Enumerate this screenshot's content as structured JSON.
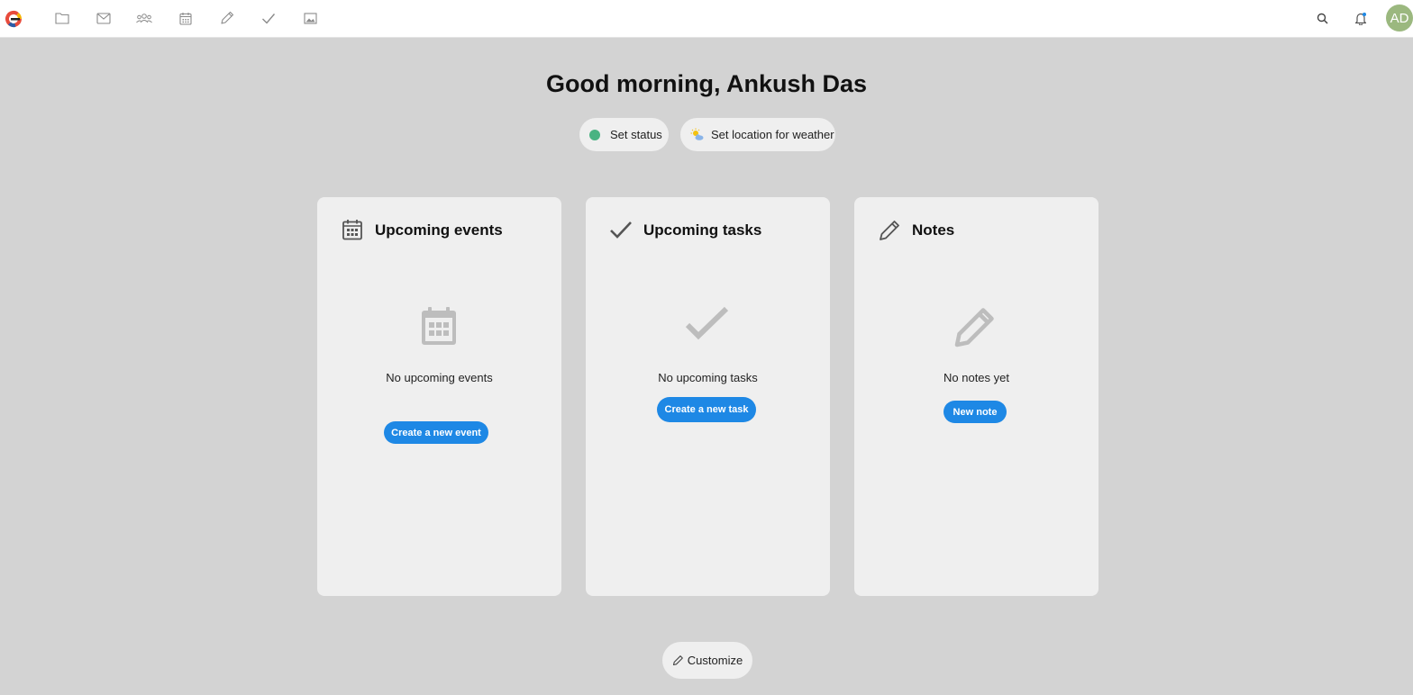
{
  "topbar": {
    "apps": [
      {
        "icon": "folder-icon",
        "label": "Files"
      },
      {
        "icon": "mail-icon",
        "label": "Mail"
      },
      {
        "icon": "contacts-icon",
        "label": "Contacts"
      },
      {
        "icon": "calendar-icon",
        "label": "Calendar"
      },
      {
        "icon": "pencil-icon",
        "label": "Notes"
      },
      {
        "icon": "check-icon",
        "label": "Tasks"
      },
      {
        "icon": "image-icon",
        "label": "Photos"
      }
    ],
    "avatar_initials": "AD",
    "avatar_color": "#9bb87f"
  },
  "greeting": "Good morning, Ankush Das",
  "status": {
    "label": "Set status",
    "dot_color": "#49b382"
  },
  "weather": {
    "label": "Set location for weather"
  },
  "cards": {
    "events": {
      "title": "Upcoming events",
      "empty": "No upcoming events",
      "action": "Create a new event"
    },
    "tasks": {
      "title": "Upcoming tasks",
      "empty": "No upcoming tasks",
      "action": "Create a new task"
    },
    "notes": {
      "title": "Notes",
      "empty": "No notes yet",
      "action": "New note"
    }
  },
  "customize_label": "Customize",
  "colors": {
    "background": "#d3d3d3",
    "card": "#efefef",
    "primary": "#1e88e5"
  }
}
